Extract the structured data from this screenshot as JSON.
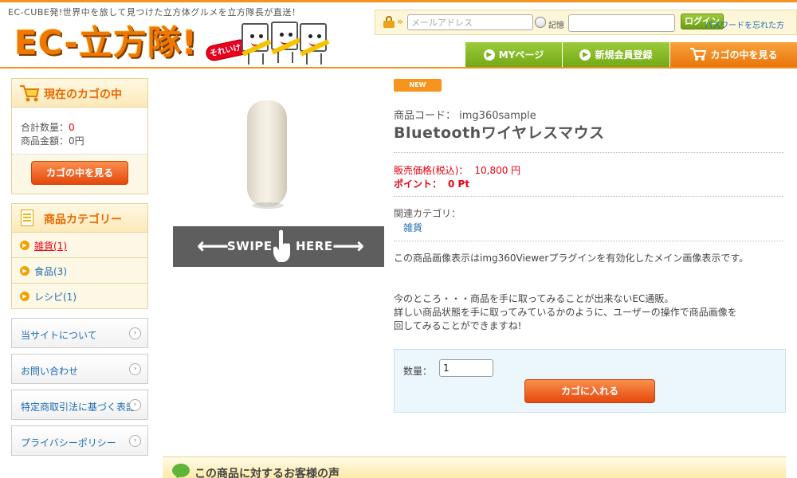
{
  "header": {
    "tagline": "EC-CUBE発!世界中を旅して見つけた立方体グルメを立方隊長が直送！",
    "logo_text": "EC-立方隊!",
    "logo_badge": "それいけ!"
  },
  "login": {
    "email_placeholder": "メールアドレス",
    "remember_label": "記憶",
    "login_button": "ログイン",
    "forgot_link": "パスワードを忘れた方"
  },
  "nav": {
    "mypage": "MYページ",
    "register": "新規会員登録",
    "cart": "カゴの中を見る"
  },
  "sidebar": {
    "cart": {
      "title": "現在のカゴの中",
      "qty_label": "合計数量：",
      "qty_value": "0",
      "amount_label": "商品金額：",
      "amount_value": "0円",
      "view_button": "カゴの中を見る"
    },
    "categories": {
      "title": "商品カテゴリー",
      "items": [
        {
          "label": "雑貨(1)"
        },
        {
          "label": "食品(3)"
        },
        {
          "label": "レシピ(1)"
        }
      ]
    },
    "links": [
      {
        "label": "当サイトについて"
      },
      {
        "label": "お問い合わせ"
      },
      {
        "label": "特定商取引法に基づく表記"
      },
      {
        "label": "プライバシーポリシー"
      }
    ]
  },
  "product": {
    "badge": "NEW",
    "code_label": "商品コード：",
    "code_value": "img360sample",
    "name": "Bluetoothワイヤレスマウス",
    "price_label": "販売価格(税込)：",
    "price_value": "10,800 円",
    "point_label": "ポイント：",
    "point_value": "0 Pt",
    "related_label": "関連カテゴリ：",
    "related_link": "雑貨",
    "description": [
      "この商品画像表示はimg360Viewerプラグインを有効化したメイン画像表示です。",
      "今のところ・・・商品を手に取ってみることが出来ないEC通販。",
      "詳しい商品状態を手に取ってみているかのように、ユーザーの操作で商品画像を",
      "回してみることができますね!"
    ],
    "swipe_left": "SWIPE",
    "swipe_right": "HERE",
    "qty_label": "数量：",
    "qty_value": "1",
    "add_to_cart": "カゴに入れる"
  },
  "reviews": {
    "title": "この商品に対するお客様の声"
  },
  "colors": {
    "accent_orange": "#f29221",
    "nav_green": "#7bae1c",
    "price_red": "#e60012",
    "link_blue": "#1d6db3"
  }
}
